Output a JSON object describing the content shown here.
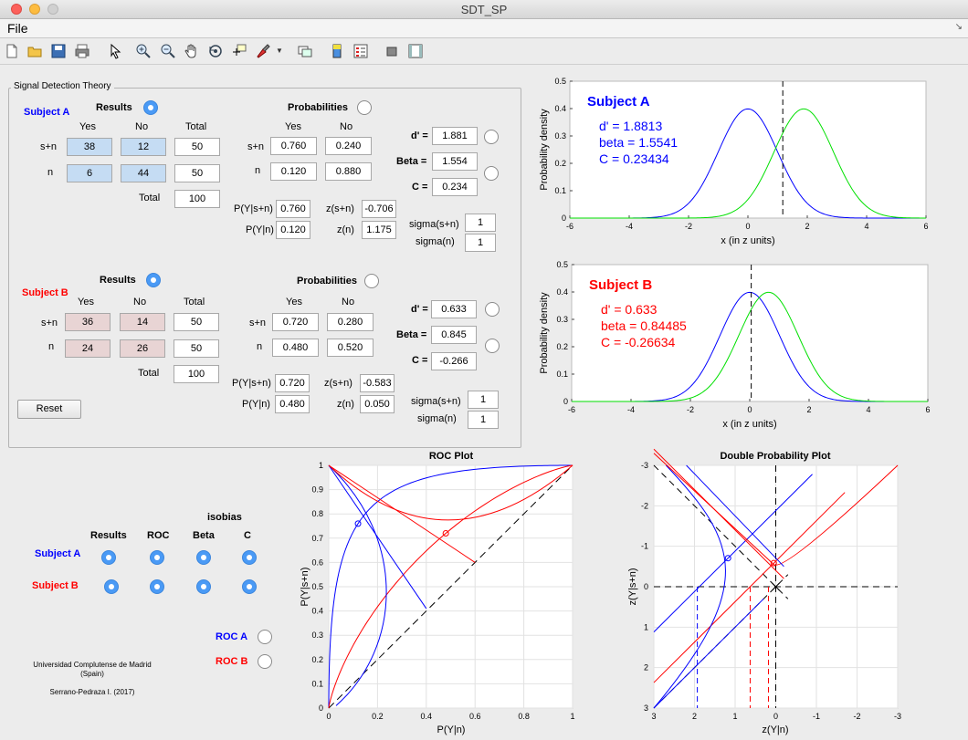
{
  "window": {
    "title": "SDT_SP"
  },
  "menu": {
    "file": "File"
  },
  "panel": {
    "title": "Signal Detection Theory"
  },
  "headers": {
    "results": "Results",
    "probabilities": "Probabilities",
    "yes": "Yes",
    "no": "No",
    "total": "Total",
    "sn": "s+n",
    "n": "n",
    "total_row": "Total",
    "pysn": "P(Y|s+n)",
    "pyn": "P(Y|n)",
    "zsn": "z(s+n)",
    "zn": "z(n)",
    "dprime": "d' =",
    "beta": "Beta =",
    "c": "C =",
    "sigma_sn": "sigma(s+n)",
    "sigma_n": "sigma(n)"
  },
  "subjectA": {
    "label": "Subject A",
    "results": {
      "sn_yes": "38",
      "sn_no": "12",
      "sn_total": "50",
      "n_yes": "6",
      "n_no": "44",
      "n_total": "50",
      "total": "100"
    },
    "probs": {
      "sn_yes": "0.760",
      "sn_no": "0.240",
      "n_yes": "0.120",
      "n_no": "0.880"
    },
    "pysn": "0.760",
    "pyn": "0.120",
    "zsn": "-0.706",
    "zn": "1.175",
    "dprime": "1.881",
    "beta": "1.554",
    "c": "0.234",
    "sigma_sn": "1",
    "sigma_n": "1"
  },
  "subjectB": {
    "label": "Subject B",
    "results": {
      "sn_yes": "36",
      "sn_no": "14",
      "sn_total": "50",
      "n_yes": "24",
      "n_no": "26",
      "n_total": "50",
      "total": "100"
    },
    "probs": {
      "sn_yes": "0.720",
      "sn_no": "0.280",
      "n_yes": "0.480",
      "n_no": "0.520"
    },
    "pysn": "0.720",
    "pyn": "0.480",
    "zsn": "-0.583",
    "zn": "0.050",
    "dprime": "0.633",
    "beta": "0.845",
    "c": "-0.266",
    "sigma_sn": "1",
    "sigma_n": "1"
  },
  "reset": "Reset",
  "isobias": {
    "title": "isobias",
    "cols": [
      "Results",
      "ROC",
      "Beta",
      "C"
    ],
    "rowA": "Subject A",
    "rowB": "Subject B"
  },
  "roc_toggles": {
    "a": "ROC A",
    "b": "ROC B"
  },
  "credits": {
    "line1": "Universidad Complutense de Madrid",
    "line2": "(Spain)",
    "line3": "Serrano-Pedraza I. (2017)"
  },
  "colors": {
    "blue": "#0000ff",
    "red": "#ff0000",
    "green": "#00e000",
    "radio_on": "#4a9af5"
  },
  "chart_data": [
    {
      "type": "line",
      "title": "Subject A",
      "annotations": [
        "d' = 1.8813",
        "beta = 1.5541",
        "C = 0.23434"
      ],
      "xlabel": "x (in z units)",
      "ylabel": "Probability density",
      "xlim": [
        -6,
        6
      ],
      "ylim": [
        0,
        0.5
      ],
      "xticks": [
        "-6",
        "-4",
        "-2",
        "0",
        "2",
        "4",
        "6"
      ],
      "yticks": [
        "0",
        "0.1",
        "0.2",
        "0.3",
        "0.4",
        "0.5"
      ],
      "series": [
        {
          "mean": 0,
          "sd": 1,
          "color": "#0000ff"
        },
        {
          "mean": 1.8813,
          "sd": 1,
          "color": "#00e000"
        }
      ],
      "criterion": 1.175
    },
    {
      "type": "line",
      "title": "Subject B",
      "annotations": [
        "d' = 0.633",
        "beta = 0.84485",
        "C = -0.26634"
      ],
      "xlabel": "x (in z units)",
      "ylabel": "Probability density",
      "xlim": [
        -6,
        6
      ],
      "ylim": [
        0,
        0.5
      ],
      "xticks": [
        "-6",
        "-4",
        "-2",
        "0",
        "2",
        "4",
        "6"
      ],
      "yticks": [
        "0",
        "0.1",
        "0.2",
        "0.3",
        "0.4",
        "0.5"
      ],
      "series": [
        {
          "mean": 0,
          "sd": 1,
          "color": "#0000ff"
        },
        {
          "mean": 0.633,
          "sd": 1,
          "color": "#00e000"
        }
      ],
      "criterion": 0.05
    },
    {
      "type": "line",
      "title": "ROC Plot",
      "xlabel": "P(Y|n)",
      "ylabel": "P(Y|s+n)",
      "xlim": [
        0,
        1
      ],
      "ylim": [
        0,
        1
      ],
      "xticks": [
        "0",
        "0.2",
        "0.4",
        "0.6",
        "0.8",
        "1"
      ],
      "yticks": [
        "0",
        "0.1",
        "0.2",
        "0.3",
        "0.4",
        "0.5",
        "0.6",
        "0.7",
        "0.8",
        "0.9",
        "1"
      ],
      "points": [
        {
          "x": 0.12,
          "y": 0.76,
          "color": "#0000ff"
        },
        {
          "x": 0.48,
          "y": 0.72,
          "color": "#ff0000"
        }
      ],
      "dprimes": [
        1.8813,
        0.633
      ]
    },
    {
      "type": "line",
      "title": "Double Probability Plot",
      "xlabel": "z(Y|n)",
      "ylabel": "z(Y|s+n)",
      "xlim": [
        3,
        -3
      ],
      "ylim": [
        3,
        -3
      ],
      "xticks": [
        "3",
        "2",
        "1",
        "0",
        "-1",
        "-2",
        "-3"
      ],
      "yticks": [
        "-3",
        "-2",
        "-1",
        "0",
        "1",
        "2",
        "3"
      ],
      "points": [
        {
          "x": 1.175,
          "y": -0.706,
          "color": "#0000ff"
        },
        {
          "x": 0.05,
          "y": -0.583,
          "color": "#ff0000"
        }
      ]
    }
  ]
}
